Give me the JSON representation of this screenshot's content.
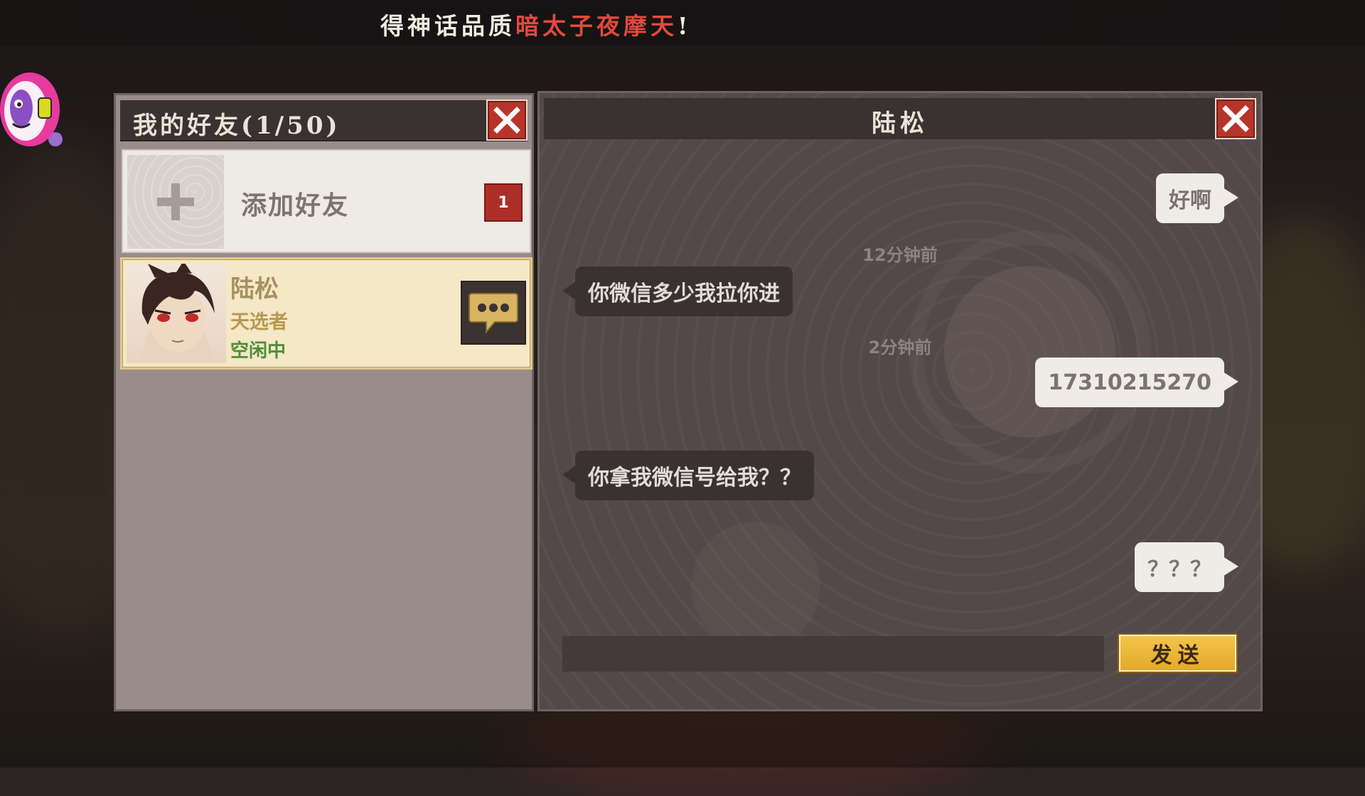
{
  "banner": {
    "prefix": "得神话品质",
    "highlight": "暗太子夜摩天",
    "suffix": "!"
  },
  "friends_panel": {
    "title": "我的好友(1/50)",
    "add_friend_label": "添加好友",
    "add_friend_badge": "1",
    "friends": [
      {
        "name": "陆松",
        "title": "天选者",
        "status": "空闲中"
      }
    ]
  },
  "chat_panel": {
    "title": "陆松",
    "messages": [
      {
        "side": "mine",
        "text": "好啊"
      },
      {
        "side": "time",
        "text": "12分钟前"
      },
      {
        "side": "theirs",
        "text": "你微信多少我拉你进"
      },
      {
        "side": "time",
        "text": "2分钟前"
      },
      {
        "side": "mine",
        "text": "17310215270"
      },
      {
        "side": "theirs",
        "text": "你拿我微信号给我？？"
      },
      {
        "side": "mine",
        "text": "？？？"
      }
    ],
    "input_value": "",
    "send_label": "发送"
  },
  "colors": {
    "accent_red": "#e24a3d",
    "send_gold": "#e8b23a",
    "status_green": "#4e8e3a"
  },
  "icons": [
    "close-icon",
    "plus-icon",
    "chat-bubble-icon",
    "mascot-icon"
  ]
}
